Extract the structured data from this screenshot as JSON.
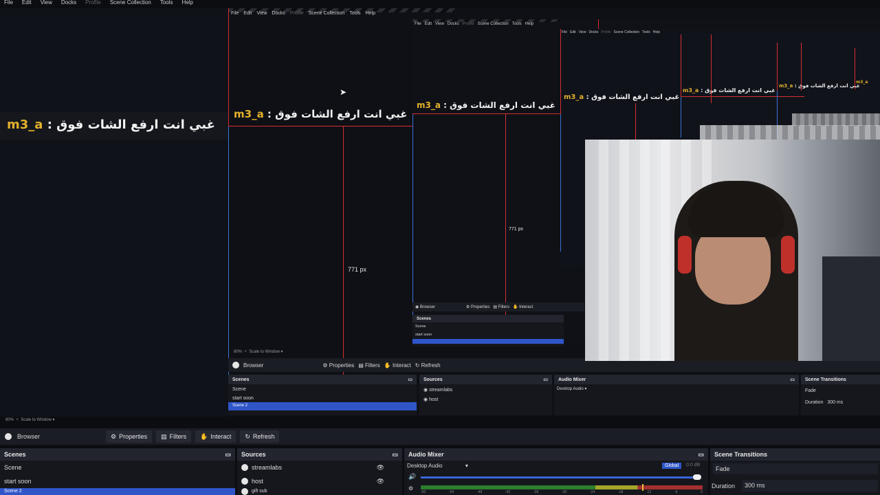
{
  "menu": [
    "File",
    "Edit",
    "View",
    "Docks",
    "Profile",
    "Scene Collection",
    "Tools",
    "Help"
  ],
  "overlay_text": {
    "prefix": "m3_a",
    "separator": " : ",
    "message": "غبي انت ارفع الشات فوق"
  },
  "measure_label": "771 px",
  "zoom": {
    "percent": "80%",
    "mode": "Scale to Window"
  },
  "source_toolbar": {
    "source_name": "Browser",
    "properties": "Properties",
    "filters": "Filters",
    "interact": "Interact",
    "refresh": "Refresh"
  },
  "scenes": {
    "title": "Scenes",
    "items": [
      "Scene",
      "start soon",
      "Scene 2"
    ]
  },
  "sources": {
    "title": "Sources",
    "items": [
      "streamlabs",
      "host",
      "gift sub"
    ]
  },
  "audio_mixer": {
    "title": "Audio Mixer",
    "device": "Desktop Audio",
    "global": "Global",
    "level": "0.0 dB",
    "ticks": [
      "-60",
      "-54",
      "-48",
      "-42",
      "-36",
      "-30",
      "-24",
      "-18",
      "-12",
      "-6",
      "0"
    ],
    "meter_fraction": 0.78
  },
  "scene_transitions": {
    "title": "Scene Transitions",
    "transition": "Fade",
    "duration_label": "Duration",
    "duration_value": "300 ms"
  }
}
